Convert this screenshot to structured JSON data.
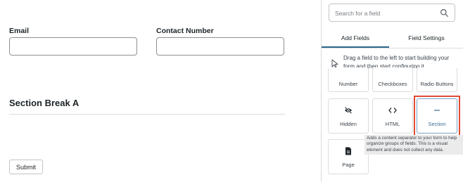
{
  "form": {
    "email_label": "Email",
    "contact_label": "Contact Number",
    "section_title": "Section Break A",
    "submit_label": "Submit"
  },
  "sidebar": {
    "search_placeholder": "Search for a field",
    "tabs": [
      {
        "label": "Add Fields",
        "active": true
      },
      {
        "label": "Field Settings",
        "active": false
      }
    ],
    "hint": "Drag a field to the left to start building your form and then start configuring it.",
    "fields_row1": [
      "Number",
      "Checkboxes",
      "Radio Buttons"
    ],
    "fields_row2": [
      {
        "label": "Hidden",
        "icon": "eye-slash-icon"
      },
      {
        "label": "HTML",
        "icon": "code-icon"
      },
      {
        "label": "Section",
        "icon": "minus-icon",
        "selected": true
      }
    ],
    "fields_row3": [
      {
        "label": "Page",
        "icon": "document-icon"
      }
    ],
    "tooltip": "Adds a content separator to your form to help organize groups of fields. This is a visual element and does not collect any data."
  },
  "colors": {
    "accent": "#2c6889",
    "highlight": "#e24a33",
    "selected_border": "#7aa4c4"
  }
}
